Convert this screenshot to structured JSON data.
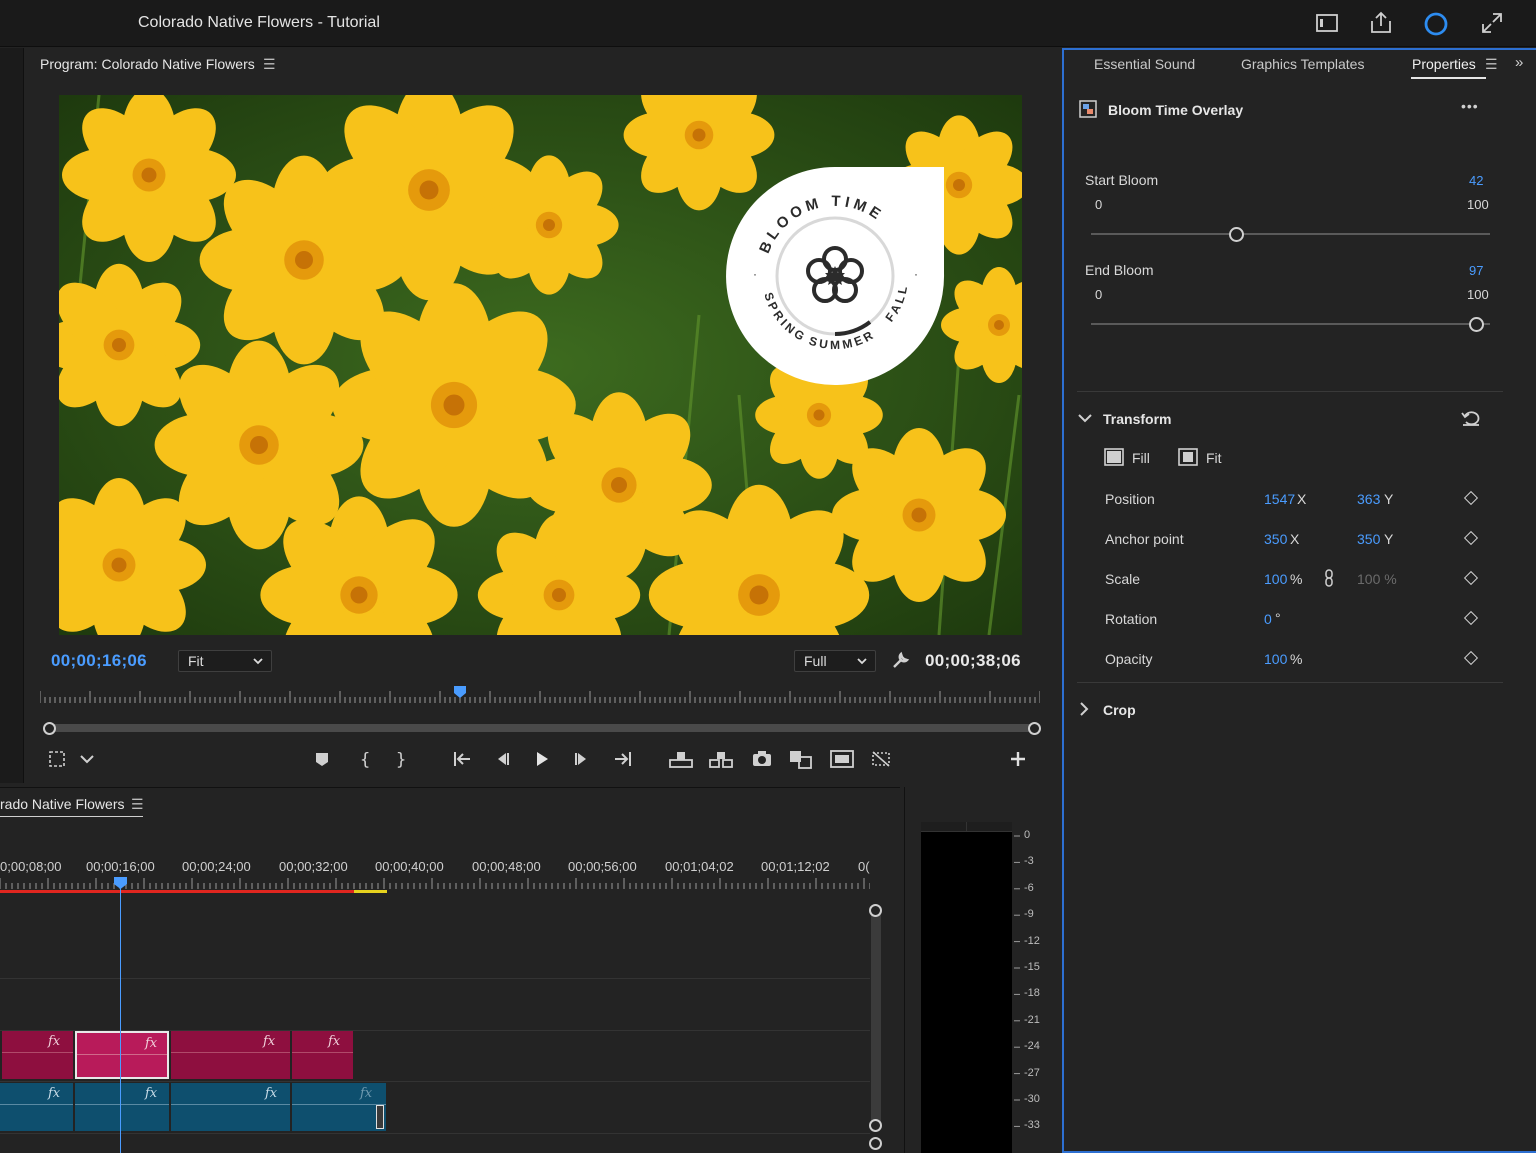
{
  "titlebar": {
    "title": "Colorado Native Flowers - Tutorial",
    "icons": [
      "panel-layout-icon",
      "share-icon",
      "progress-ring-icon",
      "fullscreen-icon"
    ]
  },
  "program_monitor": {
    "title": "Program: Colorado Native Flowers",
    "menu_icon": "hamburger-menu-icon",
    "overlay": {
      "arc_text_top": "BLOOM TIME",
      "arc_text_left": "SPRING",
      "arc_text_bottom": "SUMMER",
      "arc_text_right": "FALL",
      "dot": "·"
    },
    "current_timecode": "00;00;16;06",
    "duration_timecode": "00;00;38;06",
    "fit_dropdown": "Fit",
    "quality_dropdown": "Full",
    "playhead_fraction": 0.42
  },
  "timeline": {
    "sequence_title": "rado Native Flowers",
    "time_labels": [
      "0;00;08;00",
      "00;00;16;00",
      "00;00;24;00",
      "00;00;32;00",
      "00;00;40;00",
      "00;00;48;00",
      "00;00;56;00",
      "00;01;04;02",
      "00;01;12;02",
      "0("
    ],
    "fx_label": "fx"
  },
  "audio_meter": {
    "db_labels": [
      "0",
      "-3",
      "-6",
      "-9",
      "-12",
      "-15",
      "-18",
      "-21",
      "-24",
      "-27",
      "-30",
      "-33"
    ]
  },
  "properties_panel": {
    "tabs": [
      "Essential Sound",
      "Graphics Templates",
      "Properties"
    ],
    "active_tab": "Properties",
    "layer_title": "Bloom Time Overlay",
    "more_icon": "•••",
    "start_bloom": {
      "label": "Start Bloom",
      "value": "42",
      "min": "0",
      "max": "100",
      "fraction": 0.42
    },
    "end_bloom": {
      "label": "End Bloom",
      "value": "97",
      "min": "0",
      "max": "100",
      "fraction": 0.97
    },
    "transform": {
      "label": "Transform",
      "fill_label": "Fill",
      "fit_label": "Fit",
      "position": {
        "label": "Position",
        "x": "1547",
        "y": "363",
        "x_unit": "X",
        "y_unit": "Y"
      },
      "anchor": {
        "label": "Anchor point",
        "x": "350",
        "y": "350",
        "x_unit": "X",
        "y_unit": "Y"
      },
      "scale": {
        "label": "Scale",
        "value": "100",
        "unit": "%",
        "linked_value": "100 %"
      },
      "rotation": {
        "label": "Rotation",
        "value": "0",
        "unit": "°"
      },
      "opacity": {
        "label": "Opacity",
        "value": "100",
        "unit": "%"
      }
    },
    "crop": {
      "label": "Crop"
    }
  },
  "colors": {
    "accent_blue": "#4a9cff",
    "video_clip": "#8e0f3f",
    "audio_clip": "#0e4f6e",
    "panel_border": "#2d6fd1",
    "flower_yellow": "#f6c619"
  }
}
